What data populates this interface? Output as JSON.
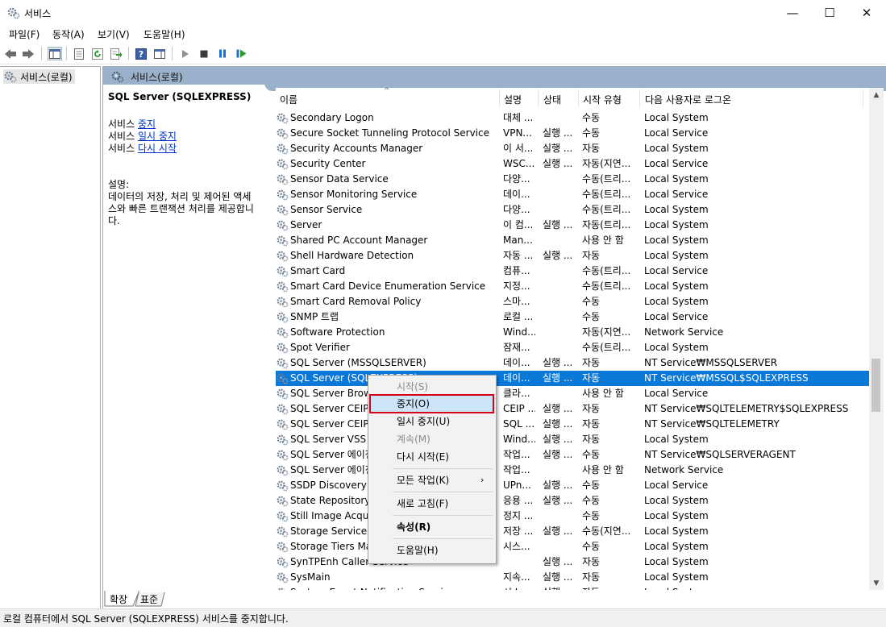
{
  "window": {
    "title": "서비스",
    "minimize_glyph": "—",
    "maximize_glyph": "☐",
    "close_glyph": "✕"
  },
  "menu": [
    "파일(F)",
    "동작(A)",
    "보기(V)",
    "도움말(H)"
  ],
  "tree": {
    "root_label": "서비스(로컬)"
  },
  "pane_header": "서비스(로컬)",
  "detail": {
    "service_name": "SQL Server (SQLEXPRESS)",
    "actions": [
      {
        "prefix": "서비스 ",
        "link": "중지"
      },
      {
        "prefix": "서비스 ",
        "link": "일시 중지"
      },
      {
        "prefix": "서비스 ",
        "link": "다시 시작"
      }
    ],
    "desc_label": "설명:",
    "desc_lines": [
      "데이터의 저장, 처리 및 제어된 액세",
      "스와 빠른 트랜잭션 처리를 제공합니",
      "다."
    ]
  },
  "columns": {
    "name": "이름",
    "desc": "설명",
    "status": "상태",
    "startup": "시작 유형",
    "logon": "다음 사용자로 로그온"
  },
  "rows": [
    {
      "name": "Secondary Logon",
      "desc": "대체 ...",
      "status": "",
      "startup": "수동",
      "logon": "Local System"
    },
    {
      "name": "Secure Socket Tunneling Protocol Service",
      "desc": "VPN...",
      "status": "실행 ...",
      "startup": "수동",
      "logon": "Local Service"
    },
    {
      "name": "Security Accounts Manager",
      "desc": "이 서...",
      "status": "실행 ...",
      "startup": "자동",
      "logon": "Local System"
    },
    {
      "name": "Security Center",
      "desc": "WSC...",
      "status": "실행 ...",
      "startup": "자동(지연...",
      "logon": "Local Service"
    },
    {
      "name": "Sensor Data Service",
      "desc": "다양...",
      "status": "",
      "startup": "수동(트리...",
      "logon": "Local System"
    },
    {
      "name": "Sensor Monitoring Service",
      "desc": "데이...",
      "status": "",
      "startup": "수동(트리...",
      "logon": "Local Service"
    },
    {
      "name": "Sensor Service",
      "desc": "다양...",
      "status": "",
      "startup": "수동(트리...",
      "logon": "Local System"
    },
    {
      "name": "Server",
      "desc": "이 컴...",
      "status": "실행 ...",
      "startup": "자동(트리...",
      "logon": "Local System"
    },
    {
      "name": "Shared PC Account Manager",
      "desc": "Man...",
      "status": "",
      "startup": "사용 안 함",
      "logon": "Local System"
    },
    {
      "name": "Shell Hardware Detection",
      "desc": "자동 ...",
      "status": "실행 ...",
      "startup": "자동",
      "logon": "Local System"
    },
    {
      "name": "Smart Card",
      "desc": "컴퓨...",
      "status": "",
      "startup": "수동(트리...",
      "logon": "Local Service"
    },
    {
      "name": "Smart Card Device Enumeration Service",
      "desc": "지정...",
      "status": "",
      "startup": "수동(트리...",
      "logon": "Local System"
    },
    {
      "name": "Smart Card Removal Policy",
      "desc": "스마...",
      "status": "",
      "startup": "수동",
      "logon": "Local System"
    },
    {
      "name": "SNMP 트랩",
      "desc": "로컬 ...",
      "status": "",
      "startup": "수동",
      "logon": "Local Service"
    },
    {
      "name": "Software Protection",
      "desc": "Wind...",
      "status": "",
      "startup": "자동(지연...",
      "logon": "Network Service"
    },
    {
      "name": "Spot Verifier",
      "desc": "잠재...",
      "status": "",
      "startup": "수동(트리...",
      "logon": "Local System"
    },
    {
      "name": "SQL Server (MSSQLSERVER)",
      "desc": "데이...",
      "status": "실행 ...",
      "startup": "자동",
      "logon": "NT Service₩MSSQLSERVER"
    },
    {
      "name": "SQL Server (SQLEXPRESS)",
      "desc": "데이...",
      "status": "실행 ...",
      "startup": "자동",
      "logon": "NT Service₩MSSQL$SQLEXPRESS"
    },
    {
      "name": "SQL Server Browser",
      "desc": "클라...",
      "status": "",
      "startup": "사용 안 함",
      "logon": "Local Service"
    },
    {
      "name": "SQL Server CEIP service (SQLEXPRESS)",
      "desc": "CEIP ...",
      "status": "실행 ...",
      "startup": "자동",
      "logon": "NT Service₩SQLTELEMETRY$SQLEXPRESS"
    },
    {
      "name": "SQL Server CEIP service (MSSQLSERVER)",
      "desc": "SQL ...",
      "status": "실행 ...",
      "startup": "자동",
      "logon": "NT Service₩SQLTELEMETRY"
    },
    {
      "name": "SQL Server VSS Writer",
      "desc": "Wind...",
      "status": "실행 ...",
      "startup": "자동",
      "logon": "Local System"
    },
    {
      "name": "SQL Server 에이전트 (MSSQLSERVER)",
      "desc": "작업...",
      "status": "실행 ...",
      "startup": "수동",
      "logon": "NT Service₩SQLSERVERAGENT"
    },
    {
      "name": "SQL Server 에이전트 (SQLEXPRESS)",
      "desc": "작업...",
      "status": "",
      "startup": "사용 안 함",
      "logon": "Network Service"
    },
    {
      "name": "SSDP Discovery",
      "desc": "UPn...",
      "status": "실행 ...",
      "startup": "수동",
      "logon": "Local Service"
    },
    {
      "name": "State Repository Service",
      "desc": "응용 ...",
      "status": "실행 ...",
      "startup": "수동",
      "logon": "Local System"
    },
    {
      "name": "Still Image Acquisition Events",
      "desc": "정지 ...",
      "status": "",
      "startup": "수동",
      "logon": "Local System"
    },
    {
      "name": "Storage Service",
      "desc": "저장 ...",
      "status": "실행 ...",
      "startup": "수동(지연...",
      "logon": "Local System"
    },
    {
      "name": "Storage Tiers Management",
      "desc": "시스...",
      "status": "",
      "startup": "수동",
      "logon": "Local System"
    },
    {
      "name": "SynTPEnh Caller Service",
      "desc": "",
      "status": "실행 ...",
      "startup": "자동",
      "logon": "Local System"
    },
    {
      "name": "SysMain",
      "desc": "지속...",
      "status": "실행 ...",
      "startup": "자동",
      "logon": "Local System"
    },
    {
      "name": "System Event Notification Service",
      "desc": "시스...",
      "status": "실행 ...",
      "startup": "자동",
      "logon": "Local System"
    }
  ],
  "selected_row_index": 17,
  "context_menu": {
    "start": "시작(S)",
    "stop": "중지(O)",
    "pause": "일시 중지(U)",
    "resume": "계속(M)",
    "restart": "다시 시작(E)",
    "all_tasks": "모든 작업(K)",
    "refresh": "새로 고침(F)",
    "properties": "속성(R)",
    "help": "도움말(H)"
  },
  "tabs": [
    "확장",
    "표준"
  ],
  "status_text": "로컬 컴퓨터에서 SQL Server (SQLEXPRESS) 서비스를 중지합니다.",
  "colors": {
    "selection": "#0a78d7",
    "header_band": "#9ab1cb",
    "highlight_border": "#d6001c",
    "link": "#0033cc"
  }
}
